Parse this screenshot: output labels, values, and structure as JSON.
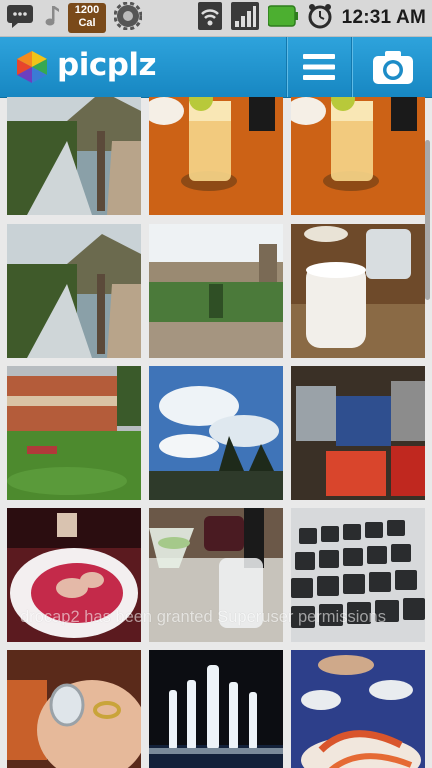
{
  "status_bar": {
    "calendar_badge": "1200\nCal",
    "time": "12:31 AM",
    "icons": [
      "chat-icon",
      "music-note-icon",
      "calendar-badge-icon",
      "gear-icon",
      "wifi-icon",
      "signal-icon",
      "battery-icon",
      "alarm-icon"
    ]
  },
  "app_bar": {
    "brand": "picplz",
    "menu_icon": "menu-icon",
    "camera_icon": "camera-icon",
    "brand_color": "#1a8fc9"
  },
  "photos": [
    {
      "subject": "river-valley"
    },
    {
      "subject": "cocktail-glass"
    },
    {
      "subject": "cocktail-glass"
    },
    {
      "subject": "river-valley"
    },
    {
      "subject": "town-square"
    },
    {
      "subject": "milky-drink"
    },
    {
      "subject": "colonial-courtyard"
    },
    {
      "subject": "cloudy-sky-trees"
    },
    {
      "subject": "luggage"
    },
    {
      "subject": "dessert-bowl"
    },
    {
      "subject": "wine-glasses"
    },
    {
      "subject": "keyboard"
    },
    {
      "subject": "ring-hand"
    },
    {
      "subject": "fountain"
    },
    {
      "subject": "seafood-dinner"
    }
  ],
  "toast": {
    "text": "drocap2 has been granted Superuser permissions"
  }
}
